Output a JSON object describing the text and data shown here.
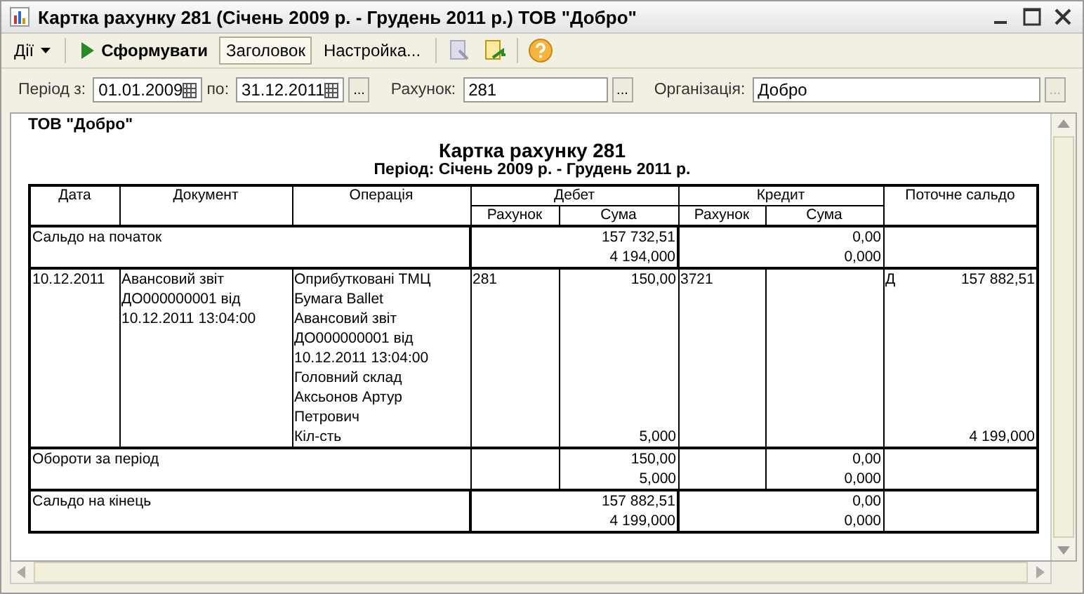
{
  "window": {
    "title": "Картка рахунку 281 (Січень 2009 р. - Грудень 2011 р.) ТОВ \"Добро\""
  },
  "toolbar": {
    "items": [
      {
        "kind": "menu",
        "label": "Дії"
      },
      {
        "kind": "run",
        "label": "Сформувати"
      },
      {
        "kind": "toggle",
        "label": "Заголовок",
        "selected": true
      },
      {
        "kind": "plain",
        "label": "Настройка..."
      }
    ]
  },
  "filters": {
    "period_from_label": "Період з:",
    "period_from": "01.01.2009",
    "period_to_label": "по:",
    "period_to": "31.12.2011",
    "account_label": "Рахунок:",
    "account": "281",
    "organization_label": "Організація:",
    "organization": "Добро",
    "period_button": "...",
    "account_button": "...",
    "organization_button": "..."
  },
  "report": {
    "organization": "ТОВ \"Добро\"",
    "title": "Картка рахунку 281",
    "subtitle": "Період: Січень 2009 р. - Грудень 2011 р.",
    "table": {
      "columns": [
        "Дата",
        "Документ",
        "Операція"
      ],
      "debit": {
        "label": "Дебет",
        "subcolumns": [
          "Рахунок",
          "Сума"
        ]
      },
      "credit": {
        "label": "Кредит",
        "subcolumns": [
          "Рахунок",
          "Сума"
        ]
      },
      "balance_column": "Поточне сальдо",
      "rows": [
        {
          "kind": "balance",
          "label": "Сальдо на початок",
          "debit": [
            "157 732,51",
            "4 194,000"
          ],
          "credit": [
            "0,00",
            "0,000"
          ]
        },
        {
          "kind": "entry",
          "date": "10.12.2011",
          "document": "Авансовий звіт\nДО000000001 від\n10.12.2011 13:04:00",
          "operation": "Оприбутковані ТМЦ\nБумага Ballet\nАвансовий звіт\nДО000000001 від\n10.12.2011 13:04:00\nГоловний склад\nАксьонов Артур\nПетрович\nКіл-сть",
          "debit_account": "281",
          "debit_sum": [
            "150,00",
            "5,000"
          ],
          "credit_account": "3721",
          "balance_side": "Д",
          "balance": [
            "157 882,51",
            "4 199,000"
          ]
        },
        {
          "kind": "turnover",
          "label": "Обороти за період",
          "debit": [
            "150,00",
            "5,000"
          ],
          "credit": [
            "0,00",
            "0,000"
          ]
        },
        {
          "kind": "balance",
          "label": "Сальдо на кінець",
          "debit": [
            "157 882,51",
            "4 199,000"
          ],
          "credit": [
            "0,00",
            "0,000"
          ]
        }
      ]
    }
  }
}
